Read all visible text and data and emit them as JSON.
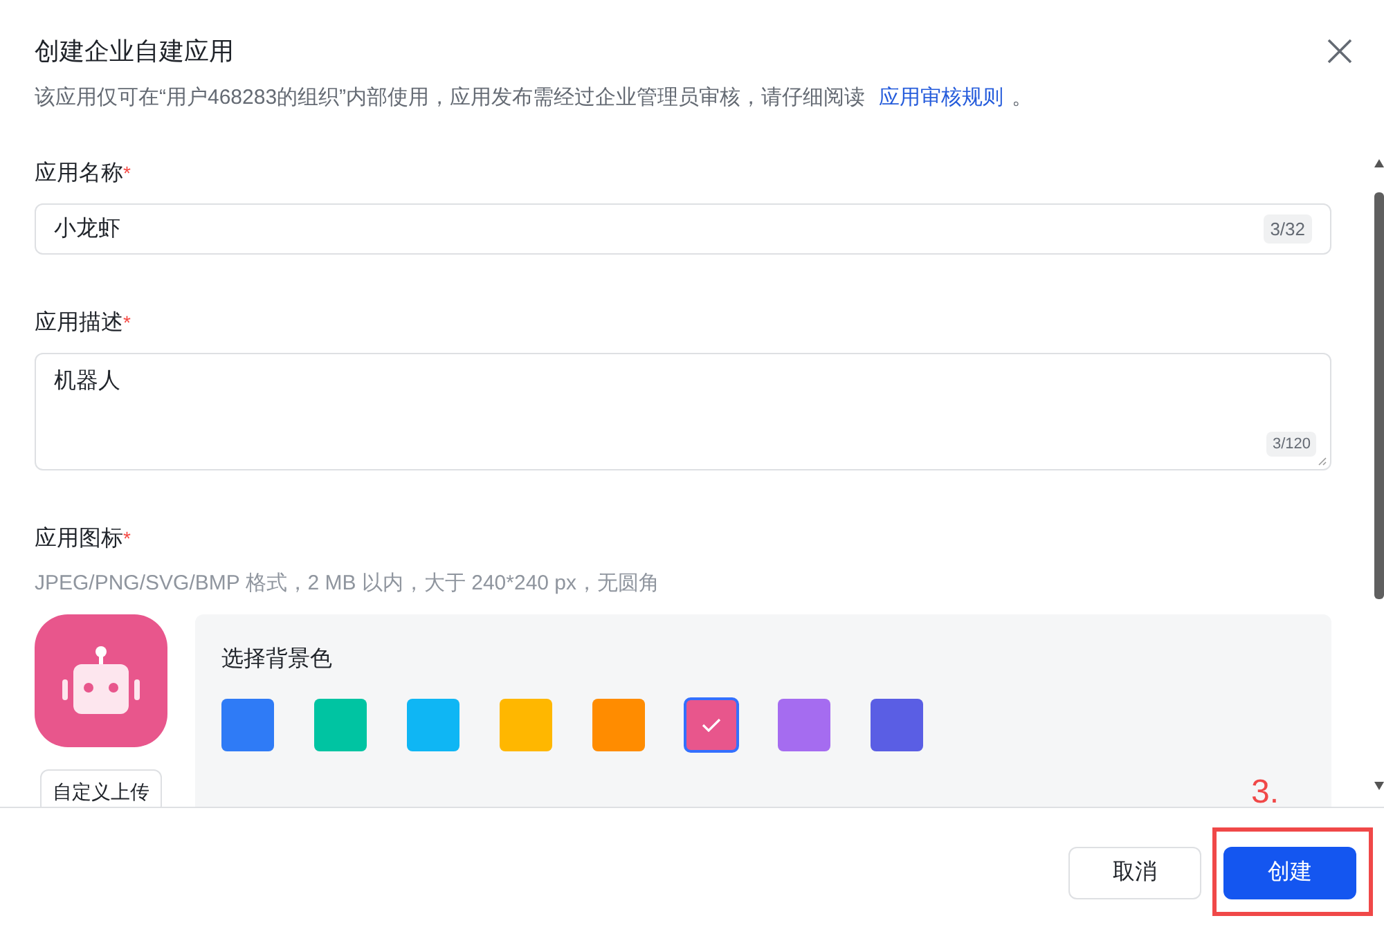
{
  "dialog": {
    "title": "创建企业自建应用",
    "notice": "该应用仅可在“用户468283的组织”内部使用，应用发布需经过企业管理员审核，请仔细阅读",
    "notice_link": "应用审核规则",
    "notice_end": "。"
  },
  "name_field": {
    "label": "应用名称",
    "required_mark": "*",
    "value": "小龙虾",
    "counter": "3/32"
  },
  "description_field": {
    "label": "应用描述",
    "required_mark": "*",
    "value": "机器人",
    "counter": "3/120"
  },
  "icon_field": {
    "label": "应用图标",
    "required_mark": "*",
    "hint": "JPEG/PNG/SVG/BMP 格式，2 MB 以内，大于 240*240 px，无圆角",
    "upload_button": "自定义上传",
    "background_title": "选择背景色",
    "swatches": [
      {
        "color": "#2f7bf6",
        "selected": false
      },
      {
        "color": "#00c4a2",
        "selected": false
      },
      {
        "color": "#0fb6f4",
        "selected": false
      },
      {
        "color": "#ffb700",
        "selected": false
      },
      {
        "color": "#ff8c00",
        "selected": false
      },
      {
        "color": "#e8568c",
        "selected": true
      },
      {
        "color": "#a56cf0",
        "selected": false
      },
      {
        "color": "#5a5ee4",
        "selected": false
      }
    ]
  },
  "annotation": {
    "text": "3."
  },
  "buttons": [
    {
      "label": "取消",
      "kind": "secondary"
    },
    {
      "label": "创建",
      "kind": "primary"
    }
  ]
}
